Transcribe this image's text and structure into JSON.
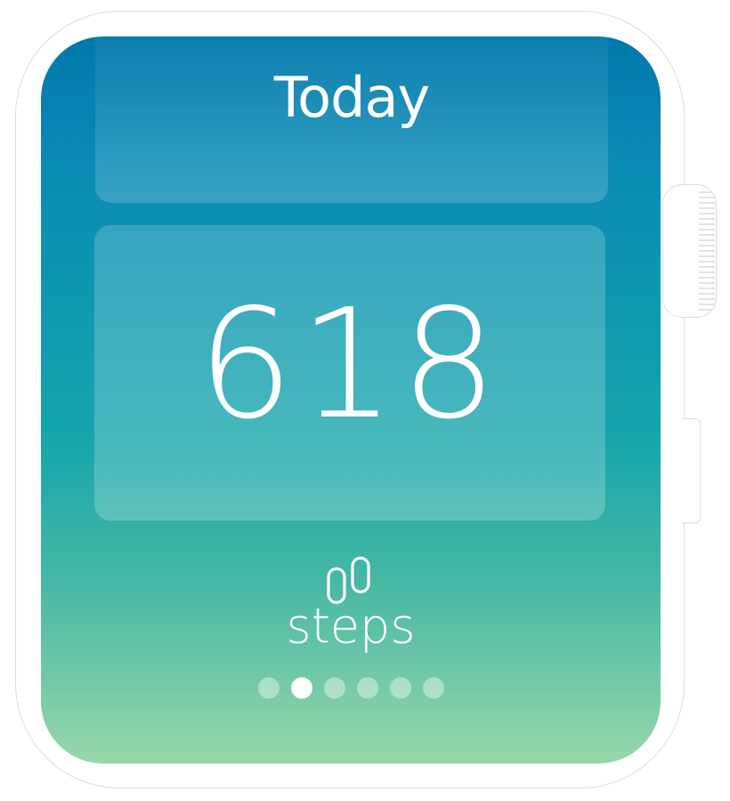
{
  "screen": {
    "title": "Today",
    "value": "618",
    "unit": "steps",
    "unit_icon": "footsteps-icon"
  },
  "pagination": {
    "total": 6,
    "active_index": 1
  },
  "colors": {
    "gradient_top": "#0278ad",
    "gradient_mid": "#15a5ab",
    "gradient_bottom": "#99d7a9",
    "text": "#ffffff"
  }
}
